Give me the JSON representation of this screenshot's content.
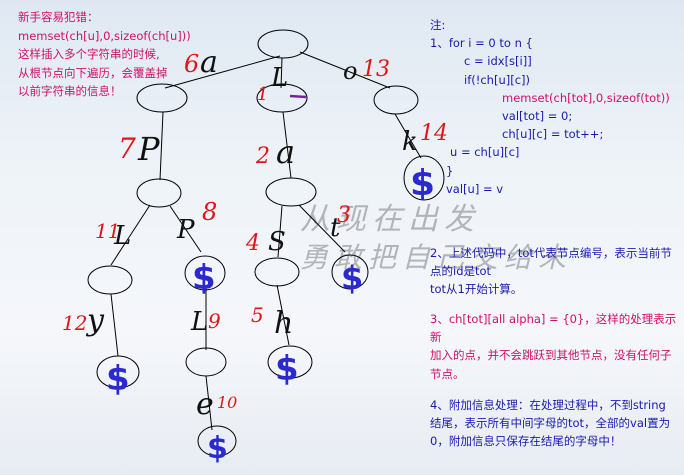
{
  "mistake_note": {
    "title": "新手容易犯错：",
    "code": "memset(ch[u],0,sizeof(ch[u]))",
    "lines": [
      "这样插入多个字符串的时候,",
      "从根节点向下遍历，会覆盖掉",
      "以前字符串的信息！"
    ]
  },
  "right_notes": {
    "header": "注:",
    "code": {
      "l1": "1、for i = 0 to n {",
      "l2": "c = idx[s[i]]",
      "l3": "if(!ch[u][c])",
      "l4": "memset(ch[tot],0,sizeof(tot))",
      "l5": "val[tot] = 0;",
      "l6": "ch[u][c] = tot++;",
      "l7": "u = ch[u][c]",
      "l8": "}",
      "l9": "val[u] = v"
    },
    "p2": [
      "2、上述代码中，tot代表节点编号，表示当前节",
      "点的id是tot",
      "tot从1开始计算。"
    ],
    "p3": [
      "3、ch[tot][all alpha] = {0}，这样的处理表示新",
      "加入的点，并不会跳跃到其他节点，没有任何子",
      "节点。"
    ],
    "p4": [
      "4、附加信息处理：在处理过程中，不到string",
      "结尾，表示所有中间字母的tot，全部的val置为",
      "0，附加信息只保存在结尾的字母中！"
    ]
  },
  "watermark": {
    "line1": "从现在出发",
    "line2": "勇敢把自己交给未"
  },
  "tree": {
    "letters": {
      "a_root": "a",
      "l_root": "L",
      "o_root": "o",
      "p_left": "P",
      "a_mid": "a",
      "k": "k",
      "l_left": "L",
      "p_mid": "P",
      "s": "S",
      "t": "t",
      "y": "y",
      "l_low": "L",
      "h": "h",
      "e": "e"
    },
    "numbers": {
      "n6": "6",
      "n1": "1",
      "n13": "13",
      "n7": "7",
      "n2": "2",
      "n14": "14",
      "n11": "11",
      "n8": "8",
      "n4": "4",
      "n3": "3",
      "n12": "12",
      "n9": "9",
      "n5": "5",
      "n10": "10"
    },
    "end_mark": "$",
    "colors": {
      "red": "#e01515",
      "black": "#111111",
      "blue": "#2a2ad0",
      "purple": "#7b1fa2"
    }
  }
}
